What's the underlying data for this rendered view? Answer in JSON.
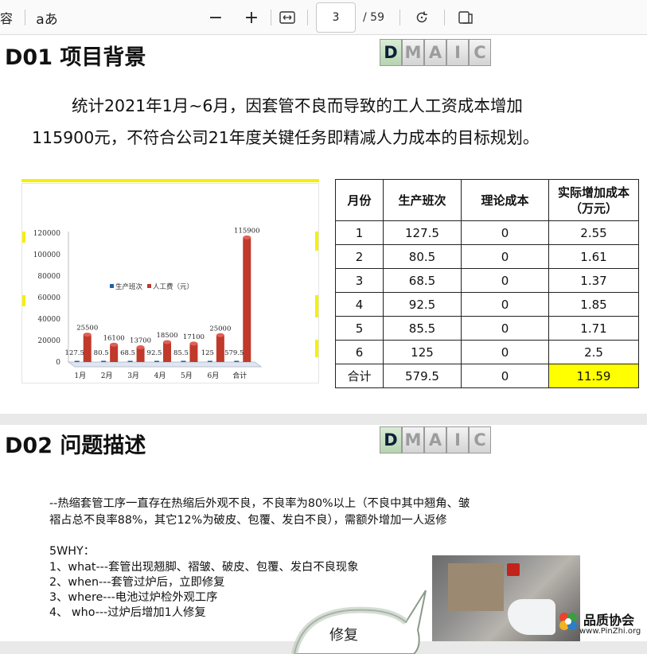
{
  "toolbar": {
    "left_fragment": "容",
    "read_aloud_label": "aあ",
    "zoom_out": "−",
    "zoom_in": "+",
    "current_page": "3",
    "total_pages": "/ 59",
    "icons": [
      "zoom-out-icon",
      "zoom-in-icon",
      "fit-width-icon",
      "rotate-icon",
      "page-view-icon"
    ]
  },
  "slide1": {
    "title": "D01 项目背景",
    "dmaic": [
      "D",
      "M",
      "A",
      "I",
      "C"
    ],
    "dmaic_active": "D",
    "intro_line1": "统计2021年1月~6月，因套管不良而导致的工人工资成本增加",
    "intro_line2": "115900元，不符合公司21年度关键任务即精减人力成本的目标规划。",
    "table": {
      "headers": [
        "月份",
        "生产班次",
        "理论成本",
        "实际增加成本（万元）"
      ],
      "rows": [
        [
          "1",
          "127.5",
          "0",
          "2.55"
        ],
        [
          "2",
          "80.5",
          "0",
          "1.61"
        ],
        [
          "3",
          "68.5",
          "0",
          "1.37"
        ],
        [
          "4",
          "92.5",
          "0",
          "1.85"
        ],
        [
          "5",
          "85.5",
          "0",
          "1.71"
        ],
        [
          "6",
          "125",
          "0",
          "2.5"
        ],
        [
          "合计",
          "579.5",
          "0",
          "11.59"
        ]
      ]
    }
  },
  "chart_data": {
    "type": "bar",
    "categories": [
      "1月",
      "2月",
      "3月",
      "4月",
      "5月",
      "6月",
      "合计"
    ],
    "series": [
      {
        "name": "生产班次",
        "values": [
          127.5,
          80.5,
          68.5,
          92.5,
          85.5,
          125,
          579.5
        ],
        "color": "#1f5fa8"
      },
      {
        "name": "人工费（元）",
        "values": [
          25500,
          16100,
          13700,
          18500,
          17100,
          25000,
          115900
        ],
        "color": "#c0392b"
      }
    ],
    "y_ticks": [
      "0",
      "20000",
      "40000",
      "60000",
      "80000",
      "100000",
      "120000"
    ],
    "ylim": [
      0,
      120000
    ],
    "legend_position": "center"
  },
  "slide2": {
    "title": "D02 问题描述",
    "dmaic": [
      "D",
      "M",
      "A",
      "I",
      "C"
    ],
    "dmaic_active": "D",
    "para1_line1": "--热缩套管工序一直存在热缩后外观不良，不良率为80%以上（不良中其中翘角、皱",
    "para1_line2": "褶占总不良率88%，其它12%为破皮、包覆、发白不良），需额外增加一人返修",
    "why_title": "5WHY：",
    "why_items": [
      "1、what---套管出现翘脚、褶皱、破皮、包覆、发白不良现象",
      "2、when---套管过炉后，立即修复",
      "3、where---电池过炉检外观工序",
      "4、  who---过炉后增加1人修复"
    ],
    "bubble_text": "修复",
    "logo_main": "品质协会",
    "logo_url": "www.PinZhi.org"
  }
}
